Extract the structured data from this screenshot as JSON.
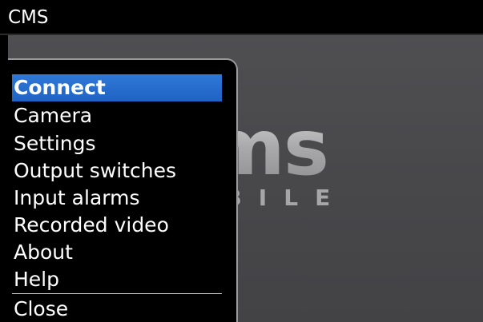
{
  "app": {
    "title": "CMS"
  },
  "logo": {
    "main_text": "cms",
    "sub_text": "MOBILE"
  },
  "menu": {
    "items": [
      {
        "label": "Connect",
        "selected": true
      },
      {
        "label": "Camera"
      },
      {
        "label": "Settings"
      },
      {
        "label": "Output switches"
      },
      {
        "label": "Input alarms"
      },
      {
        "label": "Recorded video"
      },
      {
        "label": "About"
      },
      {
        "label": "Help"
      },
      {
        "label": "Close"
      }
    ]
  },
  "colors": {
    "selection": "#1f63c4",
    "background": "#48484b",
    "menu_bg": "#000000",
    "text": "#ffffff"
  }
}
